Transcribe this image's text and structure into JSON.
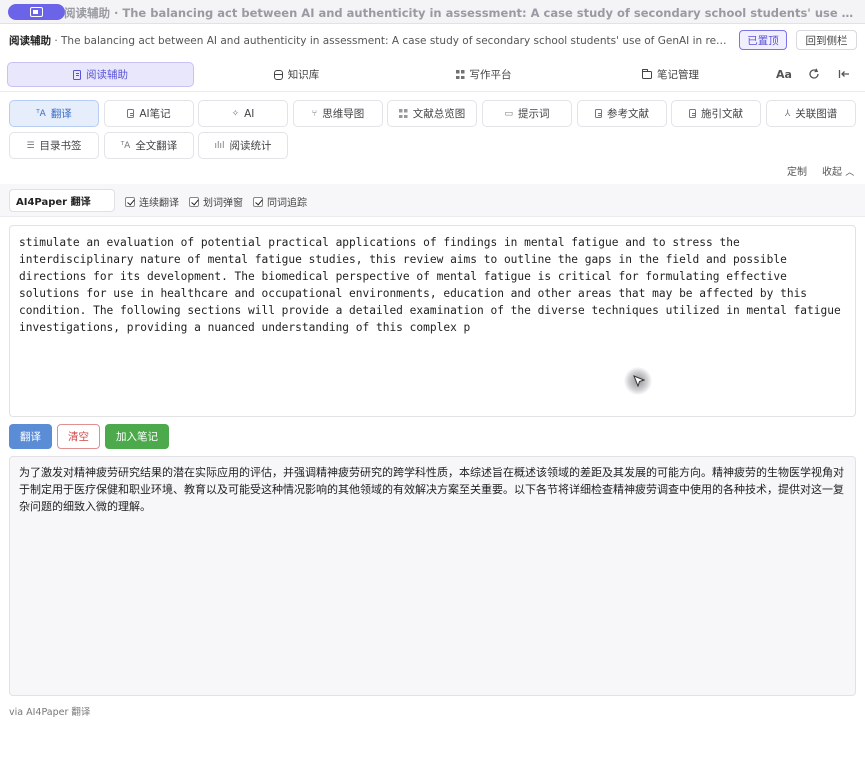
{
  "window": {
    "title": "阅读辅助 · The balancing act between AI and authenticity in assessment: A case study of secondary school students' use of GenAI in reflective wr..."
  },
  "header": {
    "label": "阅读辅助",
    "title": "The balancing act between AI and authenticity in assessment: A case study of secondary school students' use of GenAI in reflective wri...",
    "pinned_button": "已置顶",
    "back_button": "回到侧栏"
  },
  "nav": {
    "tabs": [
      {
        "label": "阅读辅助",
        "icon": "document-icon",
        "active": true
      },
      {
        "label": "知识库",
        "icon": "database-icon",
        "active": false
      },
      {
        "label": "写作平台",
        "icon": "grid-icon",
        "active": false
      },
      {
        "label": "笔记管理",
        "icon": "folder-icon",
        "active": false
      }
    ],
    "font_tool": "Aa"
  },
  "toolbar": {
    "row1": [
      {
        "label": "翻译",
        "icon": "translate-icon",
        "active": true
      },
      {
        "label": "AI笔记",
        "icon": "note-icon",
        "active": false
      },
      {
        "label": "AI",
        "icon": "sparkle-icon",
        "active": false
      },
      {
        "label": "思维导图",
        "icon": "mindmap-icon",
        "active": false
      },
      {
        "label": "文献总览图",
        "icon": "grid-icon",
        "active": false
      },
      {
        "label": "提示词",
        "icon": "chat-icon",
        "active": false
      },
      {
        "label": "参考文献",
        "icon": "reference-icon",
        "active": false
      },
      {
        "label": "施引文献",
        "icon": "citation-icon",
        "active": false
      },
      {
        "label": "关联图谱",
        "icon": "graph-icon",
        "active": false
      }
    ],
    "row2": [
      {
        "label": "目录书签",
        "icon": "list-icon",
        "active": false
      },
      {
        "label": "全文翻译",
        "icon": "translate-icon",
        "active": false
      },
      {
        "label": "阅读统计",
        "icon": "chart-icon",
        "active": false
      }
    ],
    "customize": "定制",
    "collapse": "收起"
  },
  "translate": {
    "engine": "AI4Paper 翻译",
    "options": [
      {
        "label": "连续翻译",
        "checked": true
      },
      {
        "label": "划词弹窗",
        "checked": true
      },
      {
        "label": "同词追踪",
        "checked": true
      }
    ],
    "source_text": "stimulate an evaluation of potential practical applications of findings in mental fatigue and to stress the\ninterdisciplinary nature of mental fatigue studies, this review aims to outline the gaps in the field and possible\ndirections for its development. The biomedical perspective of mental fatigue is critical for formulating effective\nsolutions for use in healthcare and occupational environments, education and other areas that may be affected by this\ncondition. The following sections will provide a detailed examination of the diverse techniques utilized in mental fatigue\ninvestigations, providing a nuanced understanding of this complex p",
    "buttons": {
      "translate": "翻译",
      "clear": "清空",
      "add_note": "加入笔记"
    },
    "result_text": "为了激发对精神疲劳研究结果的潜在实际应用的评估，并强调精神疲劳研究的跨学科性质，本综述旨在概述该领域的差距及其发展的可能方向。精神疲劳的生物医学视角对于制定用于医疗保健和职业环境、教育以及可能受这种情况影响的其他领域的有效解决方案至关重要。以下各节将详细检查精神疲劳调查中使用的各种技术，提供对这一复杂问题的细致入微的理解。",
    "footer": "via AI4Paper 翻译"
  },
  "colors": {
    "accent": "#6b63e8",
    "active_tool": "#3a6cc9",
    "translate_button": "#5b8dd6",
    "clear_button": "#d04b4b",
    "add_note_button": "#4caa4c"
  }
}
